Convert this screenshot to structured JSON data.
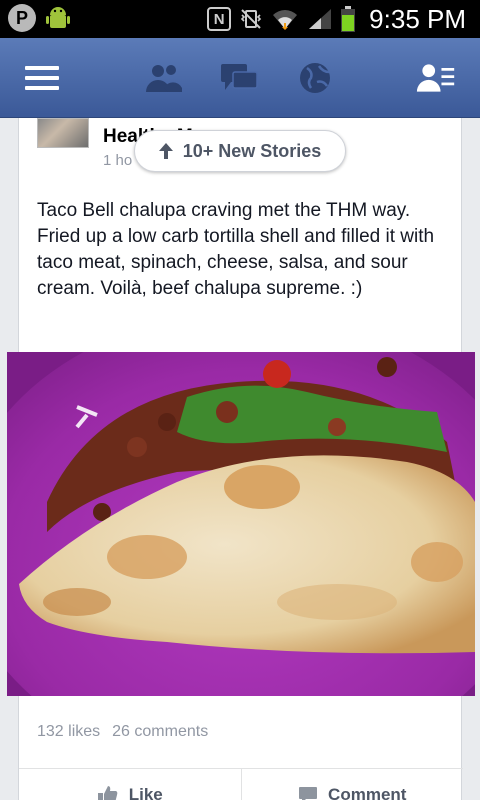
{
  "status_bar": {
    "time": "9:35 PM",
    "notification_icons": [
      "pinterest-icon",
      "android-icon"
    ],
    "system_icons": [
      "nfc-icon",
      "vibrate-icon",
      "wifi-icon",
      "signal-icon",
      "battery-icon"
    ]
  },
  "nav": {
    "icons": [
      "menu-icon",
      "friend-requests-icon",
      "messages-icon",
      "notifications-globe-icon",
      "contacts-icon"
    ]
  },
  "new_stories_label": "10+ New Stories",
  "post": {
    "author": "Healthy M",
    "time": "1 ho",
    "text": "Taco Bell chalupa craving met the THM way.  Fried up a low carb tortilla shell and filled it with taco meat, spinach, cheese, salsa, and sour cream.  Voilà, beef chalupa supreme. :)",
    "likes": "132 likes",
    "comments": "26 comments",
    "like_label": "Like",
    "comment_label": "Comment"
  },
  "colors": {
    "facebook_blue": "#3b5998",
    "status_bar": "#000000",
    "plate_purple": "#9a2aa6"
  }
}
